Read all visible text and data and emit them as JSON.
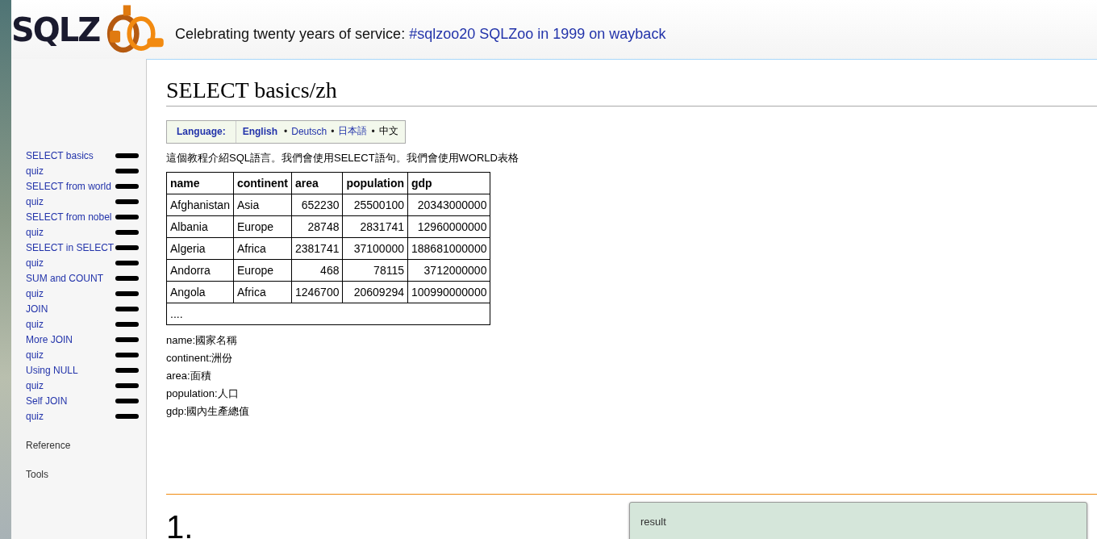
{
  "header": {
    "logo_text": "SQLZ",
    "banner": {
      "text": "Celebrating twenty years of service: ",
      "links": [
        "#sqlzoo20",
        "SQLZoo in 1999 on wayback"
      ]
    }
  },
  "sidebar": {
    "items": [
      {
        "label": "SELECT basics"
      },
      {
        "label": "quiz"
      },
      {
        "label": "SELECT from world"
      },
      {
        "label": "quiz"
      },
      {
        "label": "SELECT from nobel"
      },
      {
        "label": "quiz"
      },
      {
        "label": "SELECT in SELECT"
      },
      {
        "label": "quiz"
      },
      {
        "label": "SUM and COUNT"
      },
      {
        "label": "quiz"
      },
      {
        "label": "JOIN"
      },
      {
        "label": "quiz"
      },
      {
        "label": "More JOIN"
      },
      {
        "label": "quiz"
      },
      {
        "label": "Using NULL"
      },
      {
        "label": "quiz"
      },
      {
        "label": "Self JOIN"
      },
      {
        "label": "quiz"
      }
    ],
    "sections": [
      "Reference",
      "Tools"
    ]
  },
  "page": {
    "title": "SELECT basics/zh",
    "language": {
      "label": "Language:",
      "separator": "•",
      "options": [
        {
          "label": "English",
          "selected": false
        },
        {
          "label": "Deutsch",
          "selected": false
        },
        {
          "label": "日本語",
          "selected": false
        },
        {
          "label": "中文",
          "selected": true
        }
      ]
    },
    "intro": "這個教程介紹SQL語言。我們會使用SELECT語句。我們會使用WORLD表格",
    "table": {
      "columns": [
        {
          "label": "name",
          "numeric": false
        },
        {
          "label": "continent",
          "numeric": false
        },
        {
          "label": "area",
          "numeric": true
        },
        {
          "label": "population",
          "numeric": true
        },
        {
          "label": "gdp",
          "numeric": true
        }
      ],
      "rows": [
        [
          "Afghanistan",
          "Asia",
          "652230",
          "25500100",
          "20343000000"
        ],
        [
          "Albania",
          "Europe",
          "28748",
          "2831741",
          "12960000000"
        ],
        [
          "Algeria",
          "Africa",
          "2381741",
          "37100000",
          "188681000000"
        ],
        [
          "Andorra",
          "Europe",
          "468",
          "78115",
          "3712000000"
        ],
        [
          "Angola",
          "Africa",
          "1246700",
          "20609294",
          "100990000000"
        ]
      ],
      "more": "...."
    },
    "legend": [
      "name:國家名稱",
      "continent:洲份",
      "area:面積",
      "population:人口",
      "gdp:國內生產總值"
    ],
    "question": {
      "number": "1.",
      "result_label": "result"
    }
  }
}
